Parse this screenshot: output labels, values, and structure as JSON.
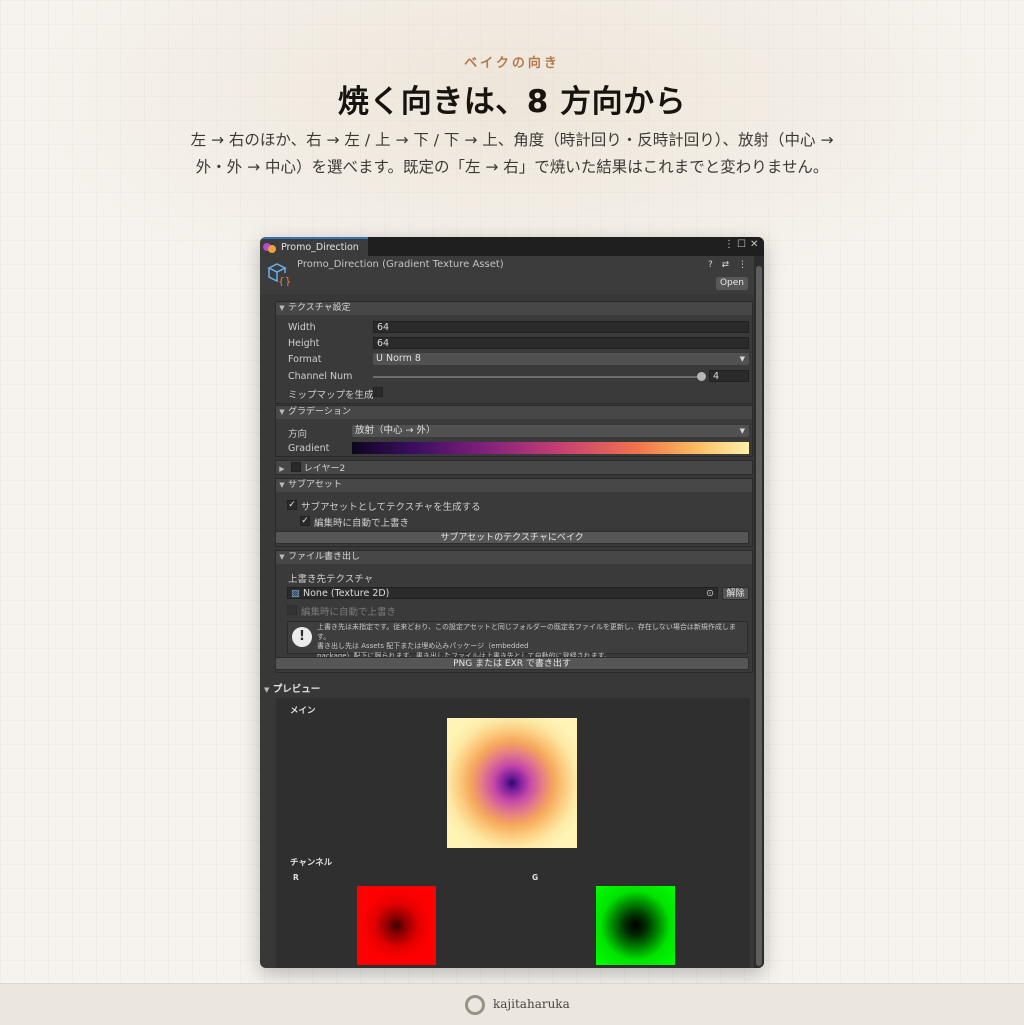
{
  "hero": {
    "eyebrow": "ベイクの向き",
    "title": "焼く向きは、8 方向から",
    "description": "左 → 右のほか、右 → 左 / 上 → 下 / 下 → 上、角度（時計回り・反時計回り）、放射（中心 → 外・外 → 中心）を選べます。既定の「左 → 右」で焼いた結果はこれまでと変わりません。"
  },
  "window": {
    "tab_label": "Promo_Direction",
    "menu_icon": "⋮",
    "maximize_icon": "☐",
    "close_icon": "✕",
    "asset_title": "Promo_Direction (Gradient Texture Asset)",
    "header_icons": "? ⇄ ⋮",
    "open_button": "Open"
  },
  "texture_settings": {
    "header": "テクスチャ設定",
    "width_label": "Width",
    "width_value": "64",
    "height_label": "Height",
    "height_value": "64",
    "format_label": "Format",
    "format_value": "U Norm 8",
    "channel_label": "Channel Num",
    "channel_value": "4",
    "channel_slider_fraction": 1.0,
    "mipmap_label": "ミップマップを生成",
    "mipmap_checked": false
  },
  "gradation": {
    "header": "グラデーション",
    "direction_label": "方向",
    "direction_value": "放射（中心 → 外）",
    "gradient_label": "Gradient"
  },
  "layer2": {
    "header": "レイヤー2",
    "enabled": false
  },
  "subasset": {
    "header": "サブアセット",
    "generate_label": "サブアセットとしてテクスチャを生成する",
    "generate_checked": true,
    "auto_overwrite_label": "編集時に自動で上書き",
    "auto_overwrite_checked": true,
    "bake_button": "サブアセットのテクスチャにベイク"
  },
  "file_export": {
    "header": "ファイル書き出し",
    "target_label": "上書き先テクスチャ",
    "target_value": "None (Texture 2D)",
    "clear_button": "解除",
    "auto_overwrite_label": "編集時に自動で上書き",
    "help_line1": "上書き先は未指定です。従来どおり、この設定アセットと同じフォルダーの既定名ファイルを更新し、存在しない場合は新規作成します。",
    "help_line2": "書き出し先は Assets 配下または埋め込みパッケージ（embedded",
    "help_line3": "package）配下に限られます。書き出したファイルは上書き先として自動的に登録されます。",
    "export_button": "PNG または EXR で書き出す"
  },
  "preview": {
    "header": "プレビュー",
    "main_label": "メイン",
    "channel_label": "チャンネル",
    "r_label": "R",
    "g_label": "G"
  },
  "footer": {
    "brand": "kajitaharuka"
  }
}
